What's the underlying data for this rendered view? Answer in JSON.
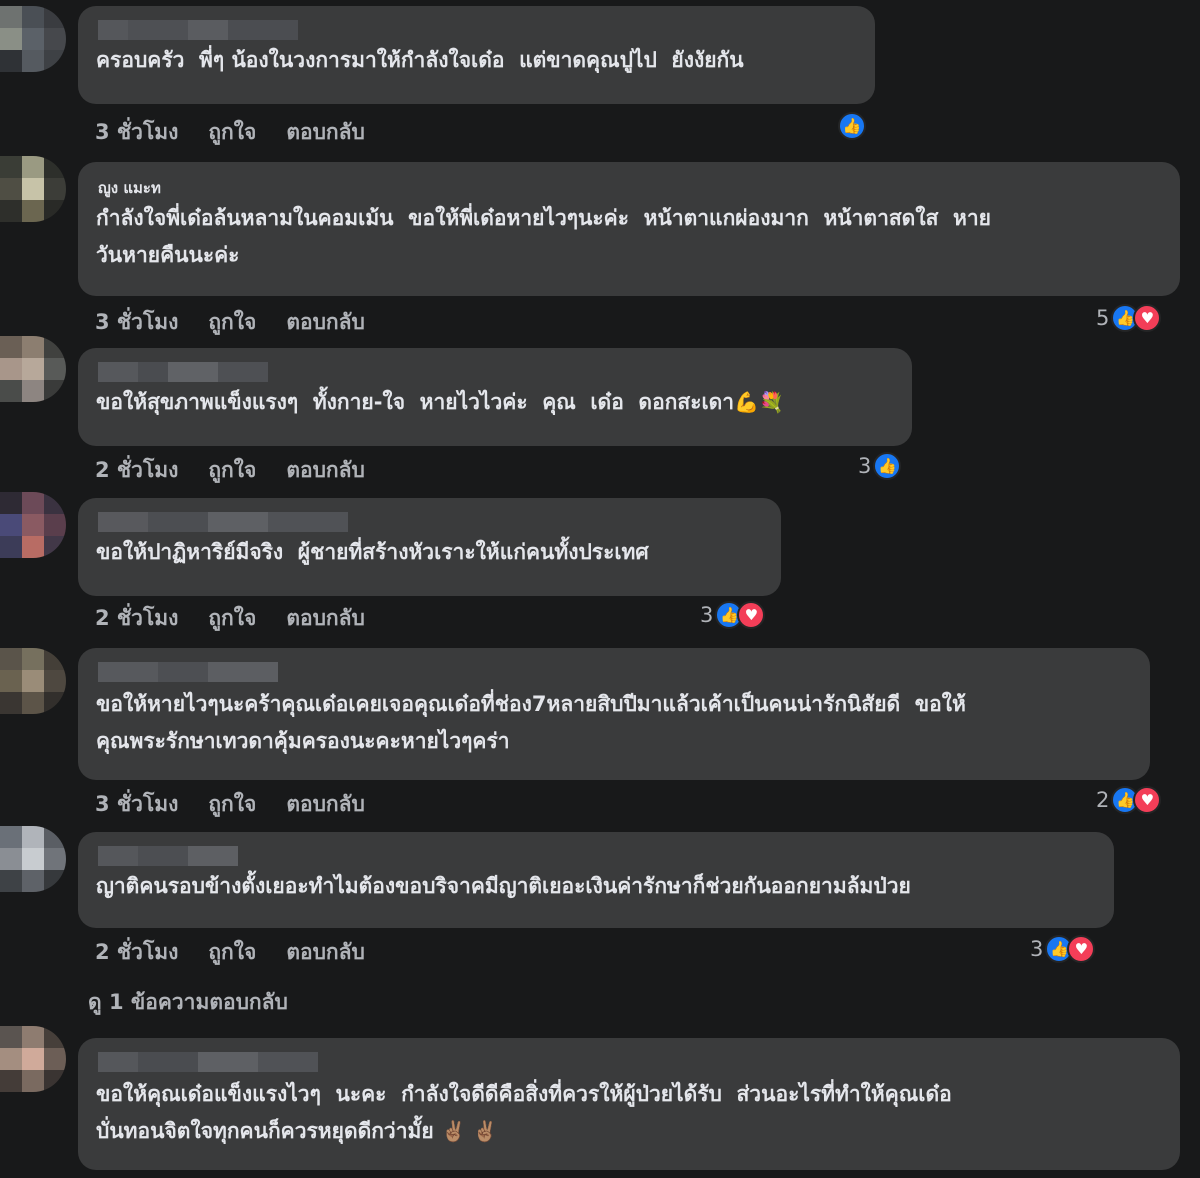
{
  "comments": [
    {
      "text": "ครอบครัว  พี่ๆ น้องในวงการมาให้กำลังใจเด๋อ  แต่ขาดคุณปูไป  ยังงัยกัน",
      "time": "3 ชั่วโมง",
      "like_label": "ถูกใจ",
      "reply_label": "ตอบกลับ",
      "reaction_count": "",
      "reactions": [
        "like"
      ]
    },
    {
      "name": "ญูง แมะท",
      "text": "กำลังใจพี่เด๋อล้นหลามในคอมเม้น  ขอให้พี่เด๋อหายไวๆนะค่ะ  หน้าตาแกผ่องมาก  หน้าตาสดใส  หาย\nวันหายคืนนะค่ะ",
      "time": "3 ชั่วโมง",
      "like_label": "ถูกใจ",
      "reply_label": "ตอบกลับ",
      "reaction_count": "5",
      "reactions": [
        "like",
        "love"
      ]
    },
    {
      "text": "ขอให้สุขภาพแข็งแรงๆ  ทั้งกาย-ใจ  หายไวไวค่ะ  คุณ  เด๋อ  ดอกสะเดา",
      "emoji": "💪💐",
      "time": "2 ชั่วโมง",
      "like_label": "ถูกใจ",
      "reply_label": "ตอบกลับ",
      "reaction_count": "3",
      "reactions": [
        "like"
      ]
    },
    {
      "text": "ขอให้ปาฏิหาริย์มีจริง  ผู้ชายที่สร้างหัวเราะให้แก่คนทั้งประเทศ",
      "time": "2 ชั่วโมง",
      "like_label": "ถูกใจ",
      "reply_label": "ตอบกลับ",
      "reaction_count": "3",
      "reactions": [
        "like",
        "love"
      ]
    },
    {
      "text": "ขอให้หายไวๆนะคร้าคุณเด๋อเคยเจอคุณเด๋อที่ช่อง7หลายสิบปีมาแล้วเค้าเป็นคนน่ารักนิสัยดี  ขอให้\nคุณพระรักษาเทวดาคุ้มครองนะคะหายไวๆคร่า",
      "time": "3 ชั่วโมง",
      "like_label": "ถูกใจ",
      "reply_label": "ตอบกลับ",
      "reaction_count": "2",
      "reactions": [
        "like",
        "love"
      ]
    },
    {
      "text": "ญาติคนรอบข้างตั้งเยอะทำไมต้องขอบริจาคมีญาติเยอะเงินค่ารักษาก็ช่วยกันออกยามล้มป่วย",
      "time": "2 ชั่วโมง",
      "like_label": "ถูกใจ",
      "reply_label": "ตอบกลับ",
      "reaction_count": "3",
      "reactions": [
        "like",
        "love"
      ]
    },
    {
      "text": "ขอให้คุณเด๋อแข็งแรงไวๆ  นะคะ  กำลังใจดีดีคือสิ่งที่ควรให้ผู้ป่วยได้รับ  ส่วนอะไรที่ทำให้คุณเด๋อ\nบั่นทอนจิตใจทุกคนก็ควรหยุดดีกว่ามั้ย",
      "emoji": "✌🏽 ✌🏽"
    }
  ],
  "view_replies": "ดู 1 ข้อความตอบกลับ",
  "colors": {
    "background": "#18191a",
    "bubble": "#3a3b3c",
    "text": "#e4e6eb",
    "meta": "#b0b3b8",
    "like": "#1877f2",
    "love": "#f33e58"
  },
  "icons": {
    "like": "thumbs-up-icon",
    "love": "heart-icon"
  }
}
